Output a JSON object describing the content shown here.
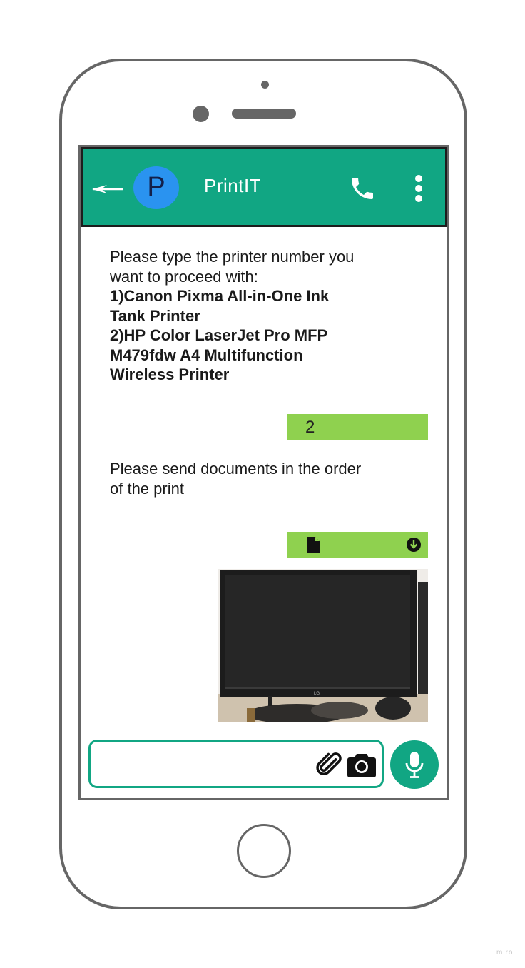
{
  "chat": {
    "contact_name": "PrintIT",
    "avatar_initial": "P",
    "messages": {
      "printer_prompt": "Please type the printer number you want to proceed with:",
      "printer_option_1": "1)Canon Pixma All-in-One Ink Tank Printer",
      "printer_option_2": "2)HP Color LaserJet Pro MFP M479fdw A4 Multifunction Wireless Printer",
      "user_reply": "2",
      "documents_prompt": "Please send documents in the order of the print"
    },
    "input": {
      "placeholder": ""
    }
  },
  "watermark": "miro",
  "colors": {
    "header": "#11a683",
    "avatar": "#2a93f0",
    "outgoing_bubble": "#8fd14f",
    "phone_frame": "#666666"
  },
  "icons": [
    "back-arrow-icon",
    "phone-icon",
    "more-vertical-icon",
    "file-icon",
    "download-icon",
    "paperclip-icon",
    "camera-icon",
    "microphone-icon"
  ]
}
